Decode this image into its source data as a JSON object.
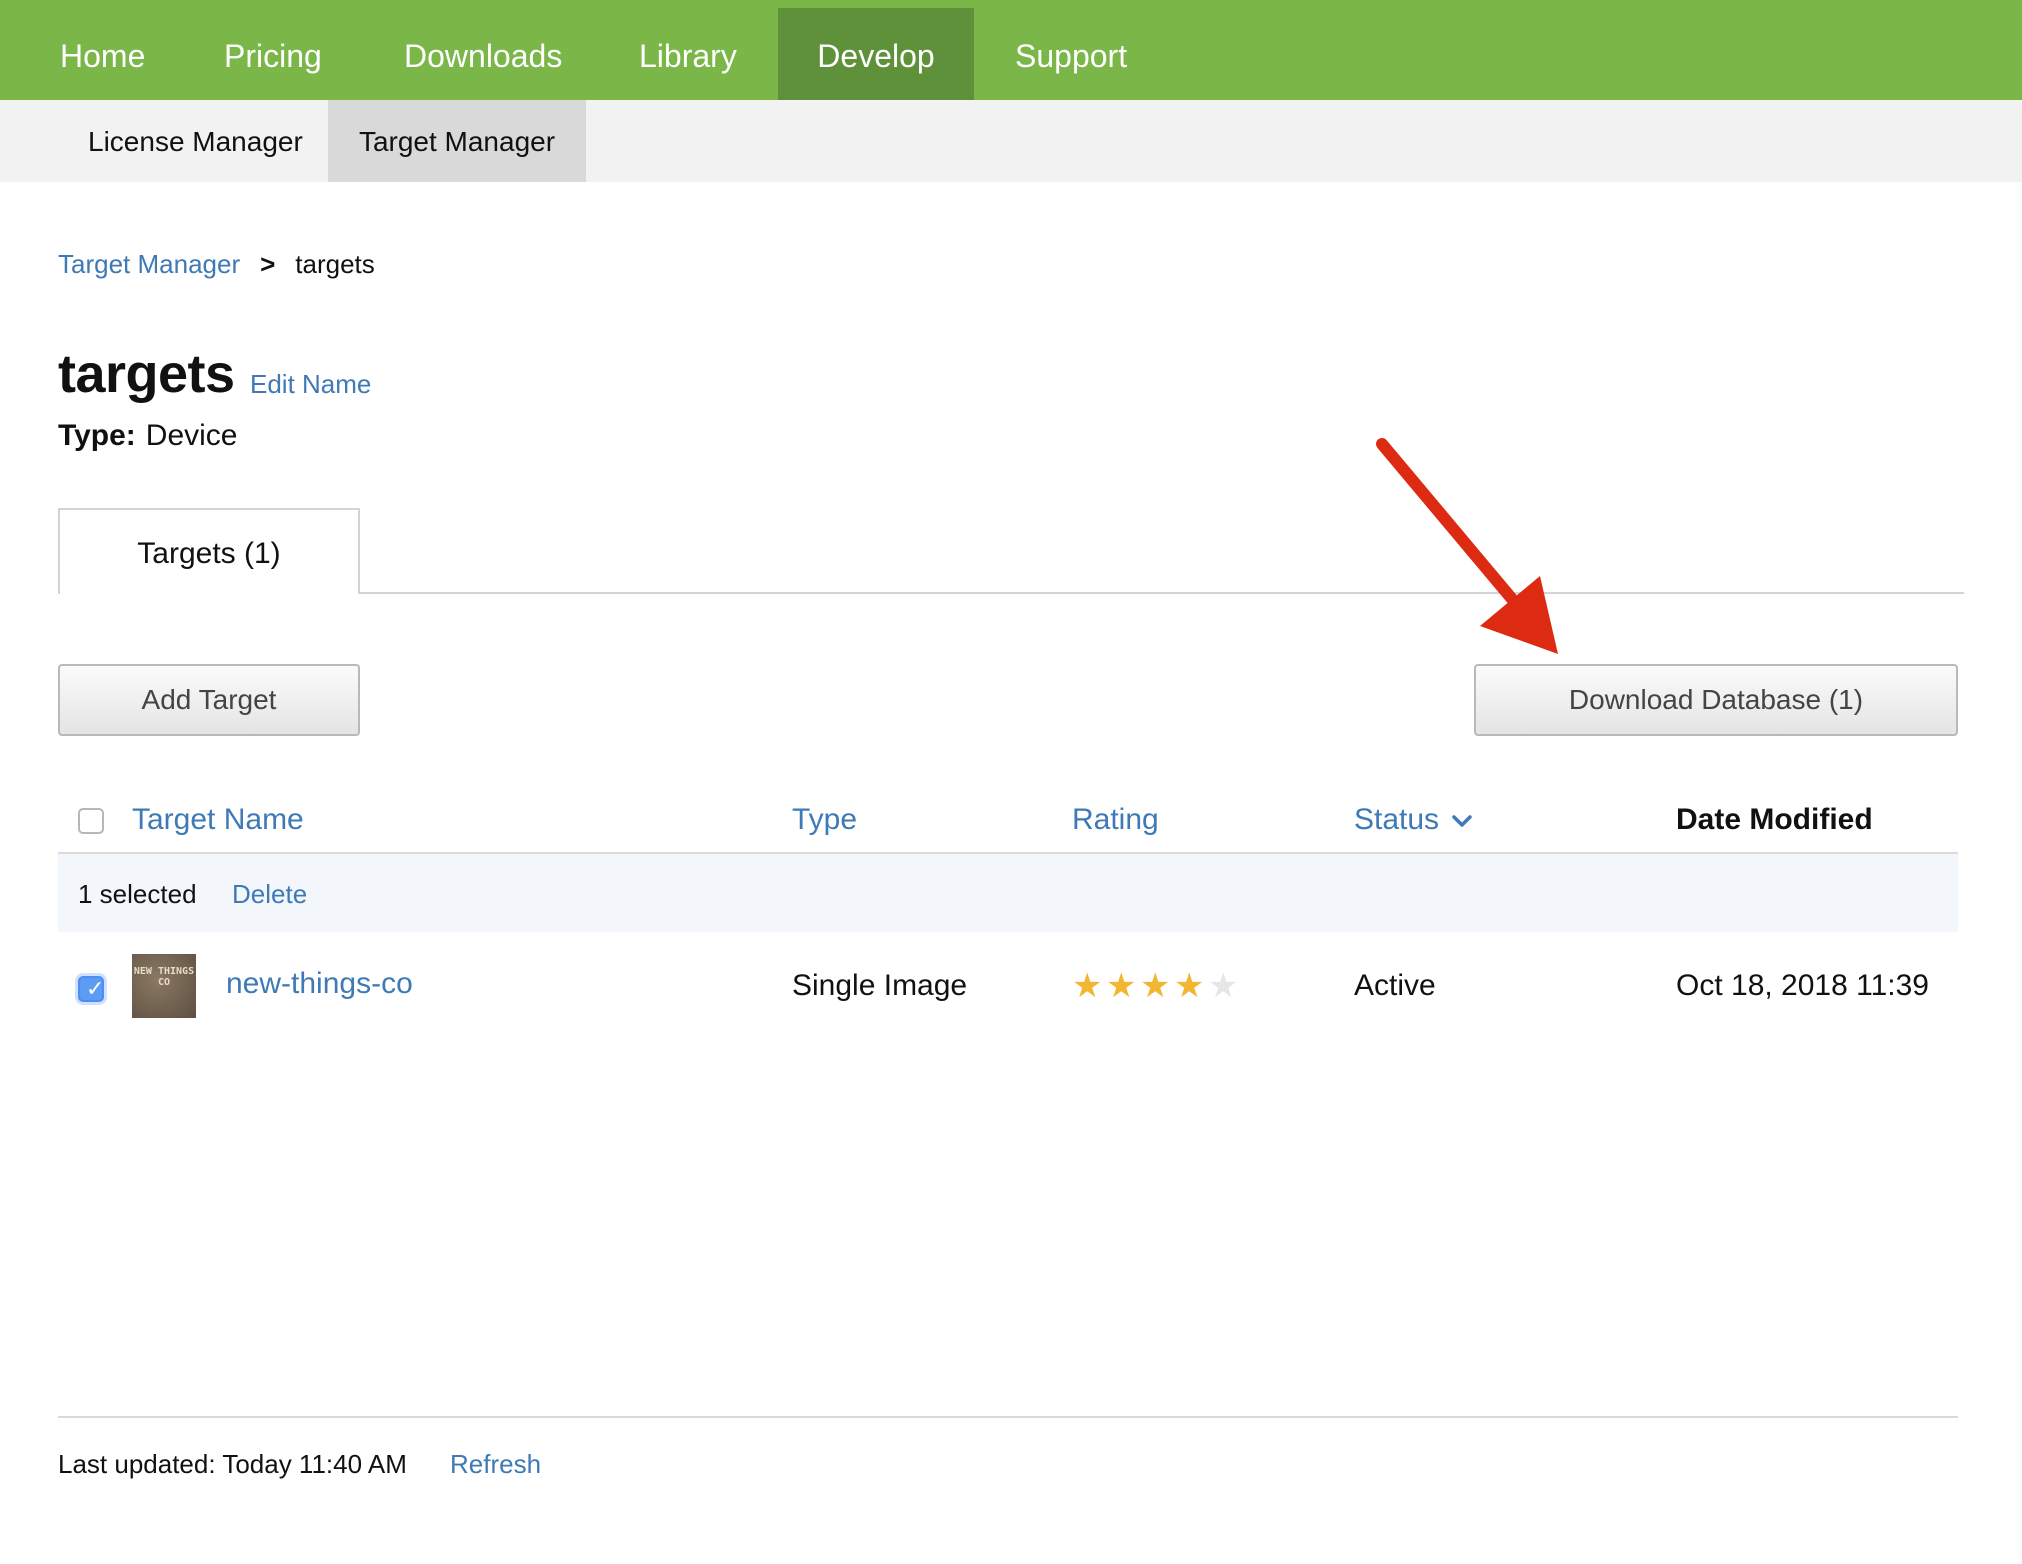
{
  "topnav": {
    "items": [
      {
        "label": "Home"
      },
      {
        "label": "Pricing"
      },
      {
        "label": "Downloads"
      },
      {
        "label": "Library"
      },
      {
        "label": "Develop",
        "active": true
      },
      {
        "label": "Support"
      }
    ]
  },
  "subnav": {
    "items": [
      {
        "label": "License Manager"
      },
      {
        "label": "Target Manager",
        "active": true
      }
    ]
  },
  "breadcrumb": {
    "parent": "Target Manager",
    "separator": ">",
    "current": "targets"
  },
  "header": {
    "title": "targets",
    "edit_label": "Edit Name",
    "type_key": "Type:",
    "type_value": "Device"
  },
  "tabs": [
    {
      "label": "Targets (1)",
      "active": true
    }
  ],
  "toolbar": {
    "add_label": "Add Target",
    "download_label": "Download Database (1)"
  },
  "table": {
    "columns": {
      "name": "Target Name",
      "type": "Type",
      "rating": "Rating",
      "status": "Status",
      "date": "Date Modified"
    },
    "selection": {
      "count_label": "1 selected",
      "delete_label": "Delete"
    },
    "rows": [
      {
        "checked": true,
        "thumb_text": "NEW THINGS CO",
        "name": "new-things-co",
        "type": "Single Image",
        "rating": 4,
        "rating_max": 5,
        "status": "Active",
        "date": "Oct 18, 2018 11:39"
      }
    ]
  },
  "footer": {
    "updated": "Last updated: Today 11:40 AM",
    "refresh_label": "Refresh"
  },
  "colors": {
    "nav_green": "#7ab648",
    "nav_active": "#5f913a",
    "link_blue": "#3f79b6",
    "star_gold": "#f2b632",
    "annotation_red": "#dd2a12"
  },
  "icons": [
    "chevron-down-icon",
    "checkmark-icon",
    "star-icon",
    "annotation-arrow-icon"
  ]
}
